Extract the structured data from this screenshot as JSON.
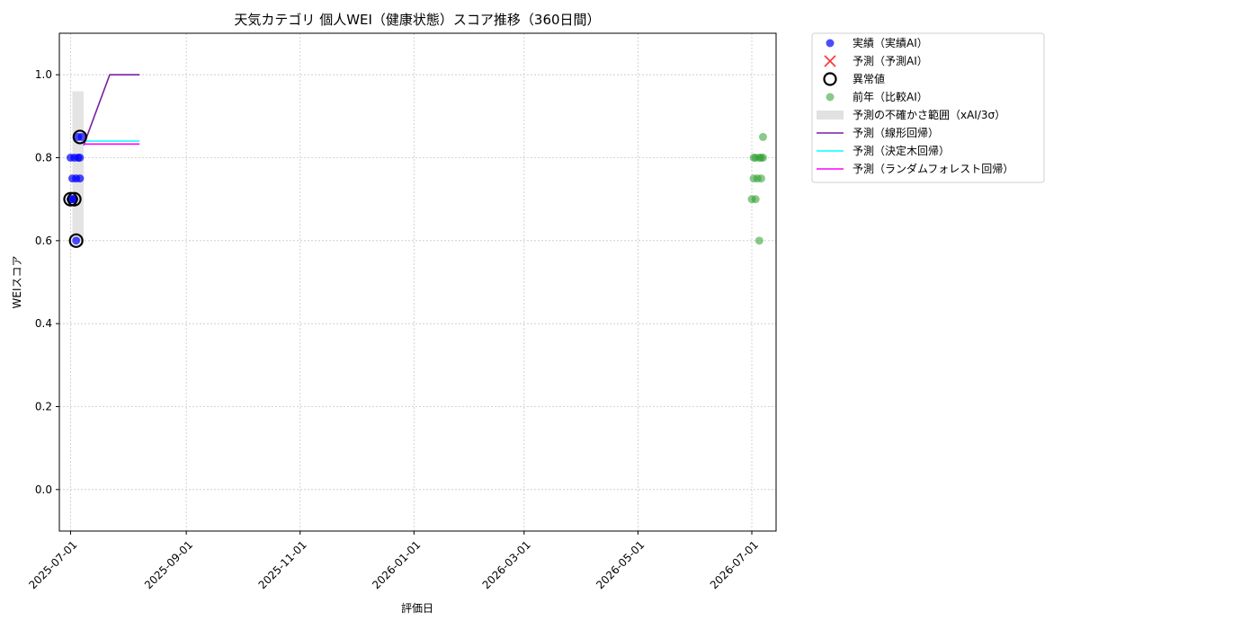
{
  "chart_data": {
    "type": "scatter",
    "title": "天気カテゴリ 個人WEI（健康状態）スコア推移（360日間）",
    "xlabel": "評価日",
    "ylabel": "WEIスコア",
    "xlim": [
      "2025-06-25",
      "2026-07-14"
    ],
    "ylim": [
      -0.1,
      1.1
    ],
    "x_ticks": [
      "2025-07-01",
      "2025-09-01",
      "2025-11-01",
      "2026-01-01",
      "2026-03-01",
      "2026-05-01",
      "2026-07-01"
    ],
    "y_ticks": [
      0.0,
      0.2,
      0.4,
      0.6,
      0.8,
      1.0
    ],
    "grid": true,
    "legend_position": "outside right, top",
    "legend": [
      {
        "key": "actual",
        "label": "実績（実績AI）",
        "marker": "dot",
        "color": "#0000ff"
      },
      {
        "key": "predicted",
        "label": "予測（予測AI）",
        "marker": "x",
        "color": "#ff0000"
      },
      {
        "key": "anomaly",
        "label": "異常値",
        "marker": "ring",
        "color": "#000000"
      },
      {
        "key": "prev_year",
        "label": "前年（比較AI）",
        "marker": "dot",
        "color": "#2a9d2a"
      },
      {
        "key": "uncertainty",
        "label": "予測の不確かさ範囲（xAI/3σ）",
        "marker": "band",
        "color": "#cccccc"
      },
      {
        "key": "linear",
        "label": "予測（線形回帰）",
        "marker": "line",
        "color": "#7b1fa2"
      },
      {
        "key": "tree",
        "label": "予測（決定木回帰）",
        "marker": "line",
        "color": "#00ffff"
      },
      {
        "key": "forest",
        "label": "予測（ランダムフォレスト回帰）",
        "marker": "line",
        "color": "#ff00ff"
      }
    ],
    "series": [
      {
        "key": "actual",
        "kind": "scatter",
        "color": "#0000ff",
        "points": [
          {
            "x": "2025-07-01",
            "y": 0.7
          },
          {
            "x": "2025-07-01",
            "y": 0.8
          },
          {
            "x": "2025-07-02",
            "y": 0.75
          },
          {
            "x": "2025-07-02",
            "y": 0.7
          },
          {
            "x": "2025-07-03",
            "y": 0.8
          },
          {
            "x": "2025-07-03",
            "y": 0.7
          },
          {
            "x": "2025-07-04",
            "y": 0.75
          },
          {
            "x": "2025-07-04",
            "y": 0.6
          },
          {
            "x": "2025-07-05",
            "y": 0.85
          },
          {
            "x": "2025-07-05",
            "y": 0.8
          },
          {
            "x": "2025-07-06",
            "y": 0.75
          },
          {
            "x": "2025-07-06",
            "y": 0.8
          },
          {
            "x": "2025-07-07",
            "y": 0.85
          }
        ]
      },
      {
        "key": "anomaly",
        "kind": "ring",
        "color": "#000000",
        "points": [
          {
            "x": "2025-07-01",
            "y": 0.7
          },
          {
            "x": "2025-07-03",
            "y": 0.7
          },
          {
            "x": "2025-07-04",
            "y": 0.6
          },
          {
            "x": "2025-07-06",
            "y": 0.85
          }
        ]
      },
      {
        "key": "prev_year",
        "kind": "scatter",
        "color": "#2a9d2a",
        "points": [
          {
            "x": "2026-07-01",
            "y": 0.7
          },
          {
            "x": "2026-07-02",
            "y": 0.8
          },
          {
            "x": "2026-07-02",
            "y": 0.75
          },
          {
            "x": "2026-07-03",
            "y": 0.8
          },
          {
            "x": "2026-07-03",
            "y": 0.7
          },
          {
            "x": "2026-07-04",
            "y": 0.75
          },
          {
            "x": "2026-07-05",
            "y": 0.8
          },
          {
            "x": "2026-07-05",
            "y": 0.6
          },
          {
            "x": "2026-07-06",
            "y": 0.75
          },
          {
            "x": "2026-07-06",
            "y": 0.8
          },
          {
            "x": "2026-07-07",
            "y": 0.85
          },
          {
            "x": "2026-07-07",
            "y": 0.8
          }
        ]
      },
      {
        "key": "uncertainty",
        "kind": "band",
        "color": "#d9d9d9",
        "x_start": "2025-07-02",
        "x_end": "2025-07-08",
        "y_low": 0.6,
        "y_high": 0.96
      },
      {
        "key": "linear",
        "kind": "line",
        "color": "#7b1fa2",
        "points": [
          {
            "x": "2025-07-08",
            "y": 0.83
          },
          {
            "x": "2025-07-22",
            "y": 1.0
          },
          {
            "x": "2025-08-07",
            "y": 1.0
          }
        ]
      },
      {
        "key": "tree",
        "kind": "line",
        "color": "#00ffff",
        "points": [
          {
            "x": "2025-07-08",
            "y": 0.84
          },
          {
            "x": "2025-08-07",
            "y": 0.84
          }
        ]
      },
      {
        "key": "forest",
        "kind": "line",
        "color": "#ff00ff",
        "points": [
          {
            "x": "2025-07-08",
            "y": 0.833
          },
          {
            "x": "2025-08-07",
            "y": 0.833
          }
        ]
      }
    ]
  }
}
